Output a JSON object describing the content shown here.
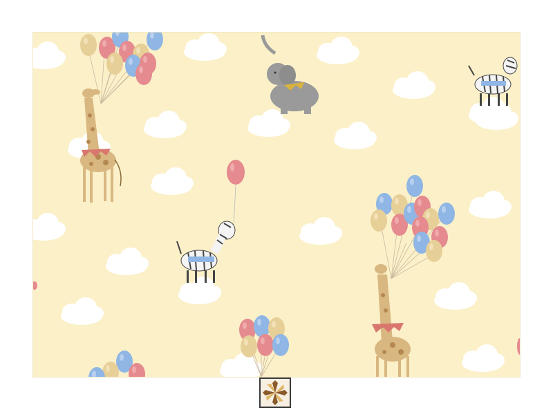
{
  "image": {
    "subject": "",
    "colors": {
      "background": "#fbf0c8",
      "cloud": "#ffffff",
      "balloon_red": "#e58a8e",
      "balloon_blue": "#8fb6e4",
      "balloon_tan": "#e7cf98",
      "giraffe": "#d9b781",
      "elephant": "#9a9a9a",
      "zebra_stripe": "#444444",
      "banner_red": "#d9776e",
      "banner_gold": "#d9b23c"
    }
  },
  "thumbnail": {
    "icon": "star-quilt-icon",
    "colors": {
      "frame": "#3a3a3a",
      "petal_dark": "#8a5a2b",
      "petal_light": "#e0b76a"
    }
  }
}
